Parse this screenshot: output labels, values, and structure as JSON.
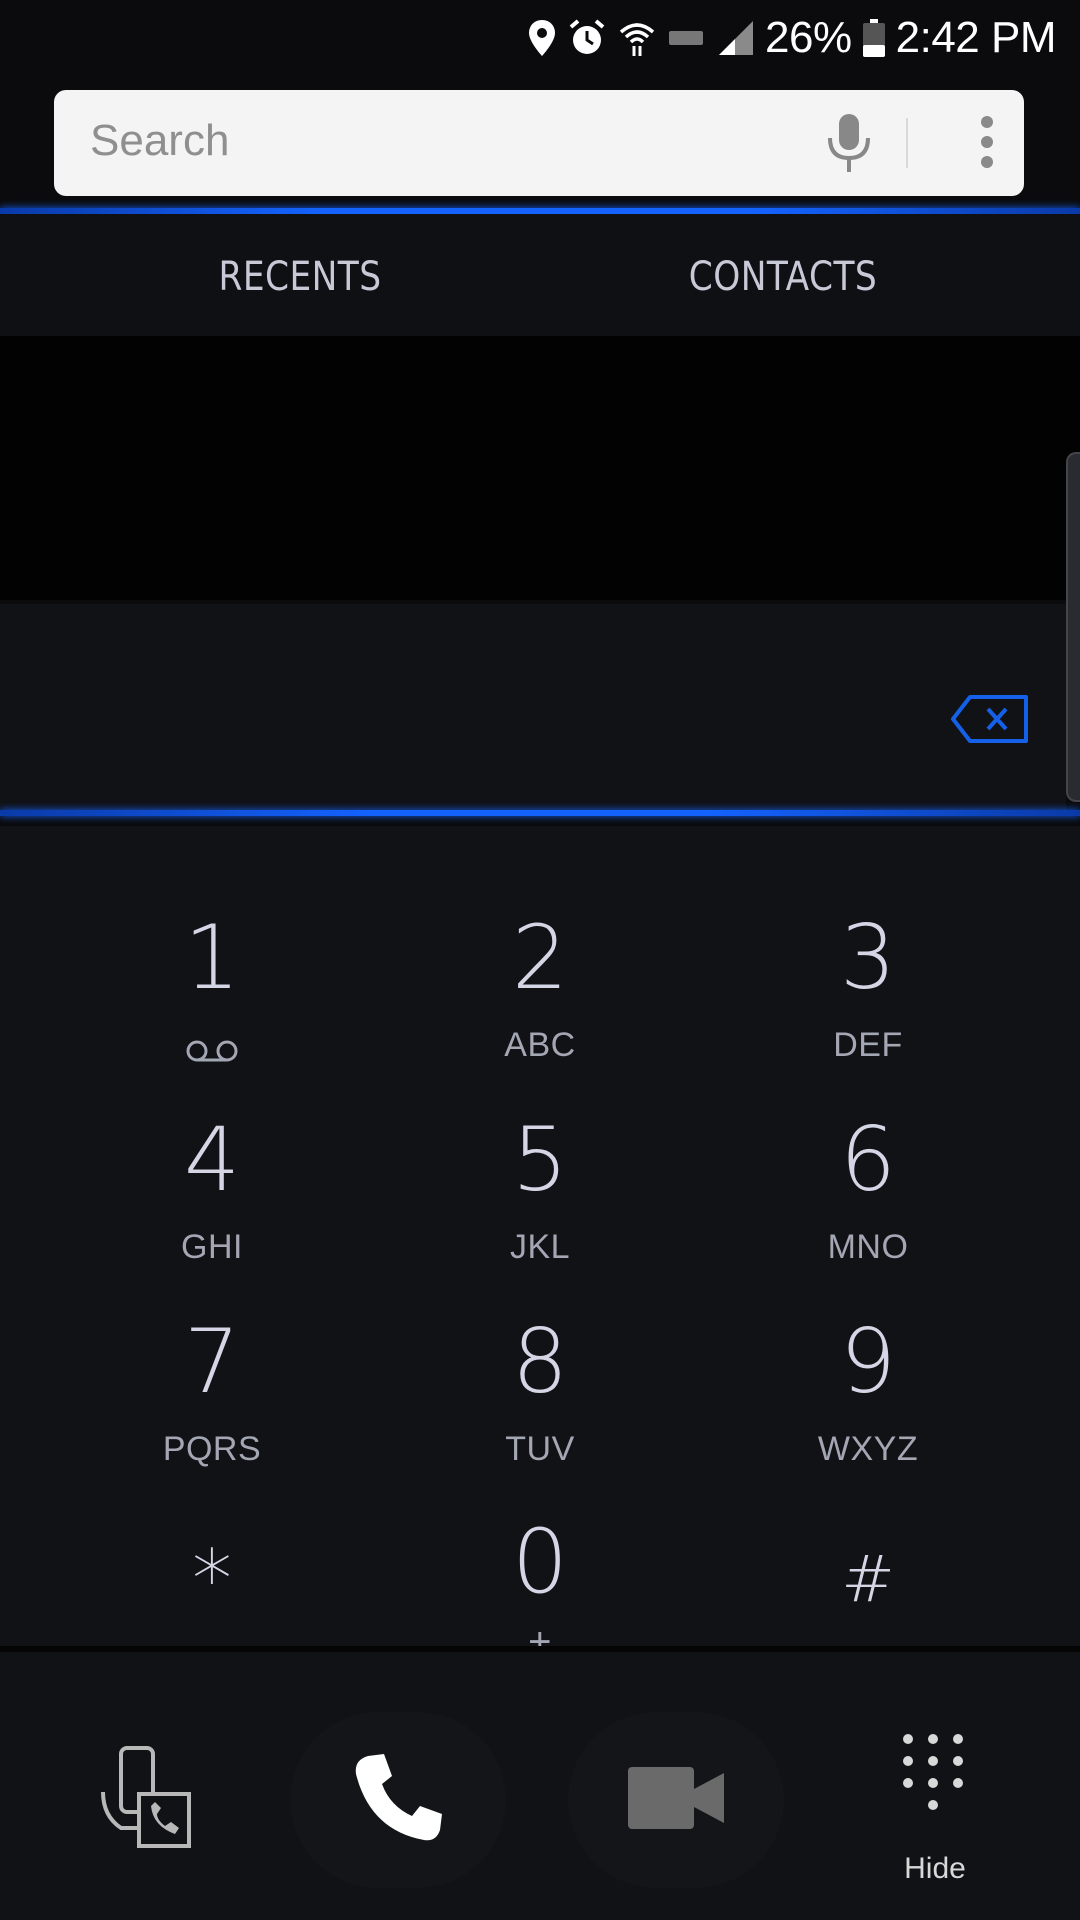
{
  "status_bar": {
    "battery_percent": "26%",
    "time": "2:42 PM",
    "icons": [
      "location-icon",
      "alarm-icon",
      "wifi-icon",
      "lte-icon",
      "signal-icon",
      "battery-icon"
    ]
  },
  "search": {
    "placeholder": "Search",
    "icons": [
      "mic-icon",
      "more-vert-icon"
    ]
  },
  "tabs": [
    {
      "label": "RECENTS"
    },
    {
      "label": "CONTACTS"
    }
  ],
  "keypad": {
    "keys": [
      {
        "digit": "1",
        "letters": ""
      },
      {
        "digit": "2",
        "letters": "ABC"
      },
      {
        "digit": "3",
        "letters": "DEF"
      },
      {
        "digit": "4",
        "letters": "GHI"
      },
      {
        "digit": "5",
        "letters": "JKL"
      },
      {
        "digit": "6",
        "letters": "MNO"
      },
      {
        "digit": "7",
        "letters": "PQRS"
      },
      {
        "digit": "8",
        "letters": "TUV"
      },
      {
        "digit": "9",
        "letters": "WXYZ"
      },
      {
        "digit": "*",
        "letters": ""
      },
      {
        "digit": "0",
        "letters": "+"
      },
      {
        "digit": "#",
        "letters": ""
      }
    ]
  },
  "actions": {
    "hide_label": "Hide"
  },
  "colors": {
    "accent_blue": "#1463ff",
    "background": "#111216"
  }
}
